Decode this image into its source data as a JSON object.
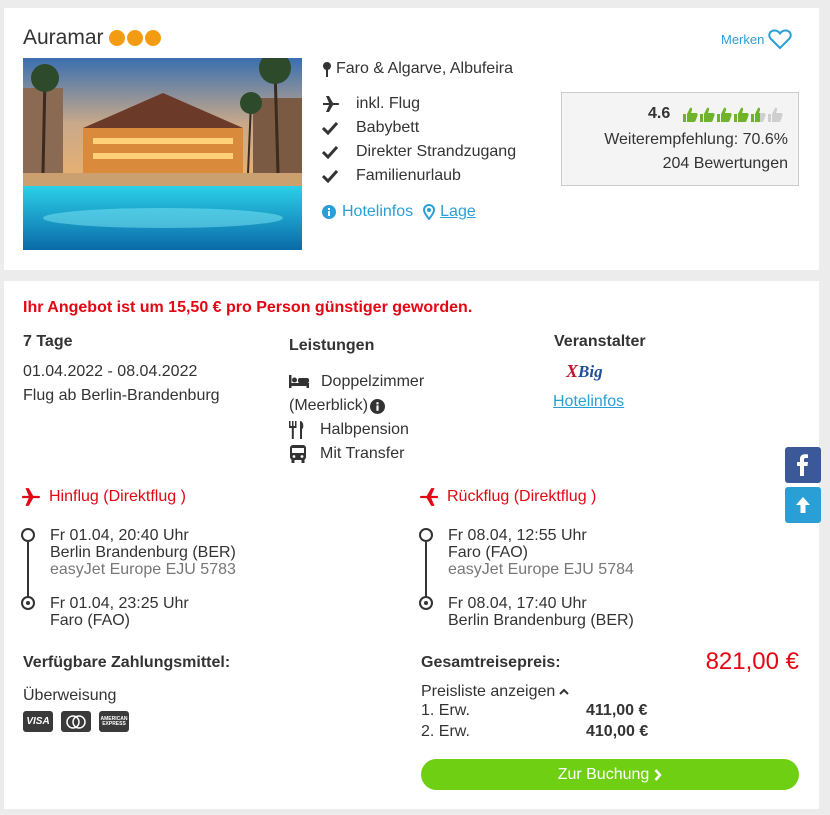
{
  "hotel": {
    "name": "Auramar",
    "stars": 3,
    "save_label": "Merken",
    "location": "Faro & Algarve, Albufeira",
    "features": [
      {
        "icon": "plane-icon",
        "label": "inkl. Flug"
      },
      {
        "icon": "check-icon",
        "label": "Babybett"
      },
      {
        "icon": "check-icon",
        "label": "Direkter Strandzugang"
      },
      {
        "icon": "check-icon",
        "label": "Familienurlaub"
      }
    ],
    "hotelinfo_link": "Hotelinfos",
    "location_link": "Lage",
    "rating": {
      "score": "4.6",
      "score_value": 4.6,
      "recommendation": "Weiterempfehlung: 70.6%",
      "reviews": "204 Bewertungen"
    }
  },
  "offer": {
    "price_notice": "Ihr Angebot ist um 15,50 € pro Person günstiger geworden.",
    "duration": "7 Tage",
    "dates": "01.04.2022 - 08.04.2022",
    "departure": "Flug ab Berlin-Brandenburg",
    "services_heading": "Leistungen",
    "services": {
      "room": "Doppelzimmer",
      "room_detail": "(Meerblick)",
      "board": "Halbpension",
      "transfer": "Mit Transfer"
    },
    "operator_heading": "Veranstalter",
    "operator_logo": "XBig",
    "operator_link": "Hotelinfos",
    "outbound": {
      "title": "Hinflug (Direktflug )",
      "dep_time": "Fr 01.04, 20:40 Uhr",
      "dep_airport": "Berlin Brandenburg (BER)",
      "carrier": "easyJet Europe EJU 5783",
      "arr_time": "Fr 01.04, 23:25 Uhr",
      "arr_airport": "Faro (FAO)"
    },
    "return": {
      "title": "Rückflug (Direktflug )",
      "dep_time": "Fr 08.04, 12:55 Uhr",
      "dep_airport": "Faro (FAO)",
      "carrier": "easyJet Europe EJU 5784",
      "arr_time": "Fr 08.04, 17:40 Uhr",
      "arr_airport": "Berlin Brandenburg (BER)"
    },
    "payment_heading": "Verfügbare Zahlungsmittel:",
    "payment_method": "Überweisung",
    "payment_icons": [
      "VISA",
      "mastercard",
      "AMERICAN EXPRESS"
    ],
    "total_label": "Gesamtreisepreis:",
    "total_price": "821,00 €",
    "pricelist_toggle": "Preisliste anzeigen",
    "pricelist": [
      {
        "label": "1. Erw.",
        "price": "411,00 €"
      },
      {
        "label": "2. Erw.",
        "price": "410,00 €"
      }
    ],
    "book_button": "Zur Buchung"
  },
  "colors": {
    "accent": "#2a9fd6",
    "red": "#e30613",
    "green": "#6fcf13",
    "orange": "#f39c12",
    "facebook": "#3b5998"
  }
}
